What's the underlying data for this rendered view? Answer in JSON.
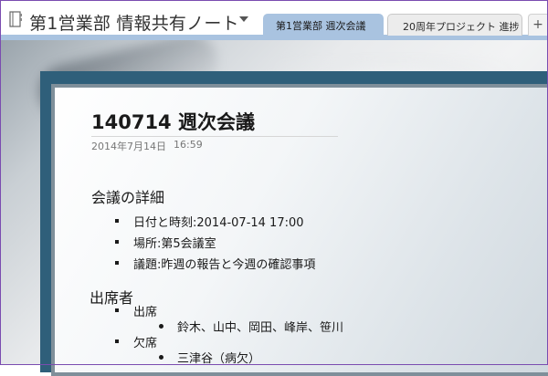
{
  "notebook": {
    "title": "第1営業部 情報共有ノート",
    "icon": "notebook-icon",
    "dropdown_icon": "chevron-down-icon"
  },
  "tabs": [
    {
      "label": "第1営業部 週次会議",
      "active": true
    },
    {
      "label": "20周年プロジェクト 進捗",
      "active": false
    }
  ],
  "add_tab_label": "+",
  "page": {
    "title": "140714 週次会議",
    "date": "2014年7月14日",
    "time": "16:59"
  },
  "details": {
    "heading": "会議の詳細",
    "items": [
      "日付と時刻:2014-07-14 17:00",
      "場所:第5会議室",
      "議題:昨週の報告と今週の確認事項"
    ]
  },
  "attendees": {
    "heading": "出席者",
    "present_label": "出席",
    "present_names": "鈴木、山中、岡田、峰岸、笹川",
    "absent_label": "欠席",
    "absent_names": "三津谷（病欠）"
  },
  "colors": {
    "tab_active": "#a9c3e0",
    "note_frame": "#2f5f7a",
    "window_border": "#7a4cb0"
  }
}
